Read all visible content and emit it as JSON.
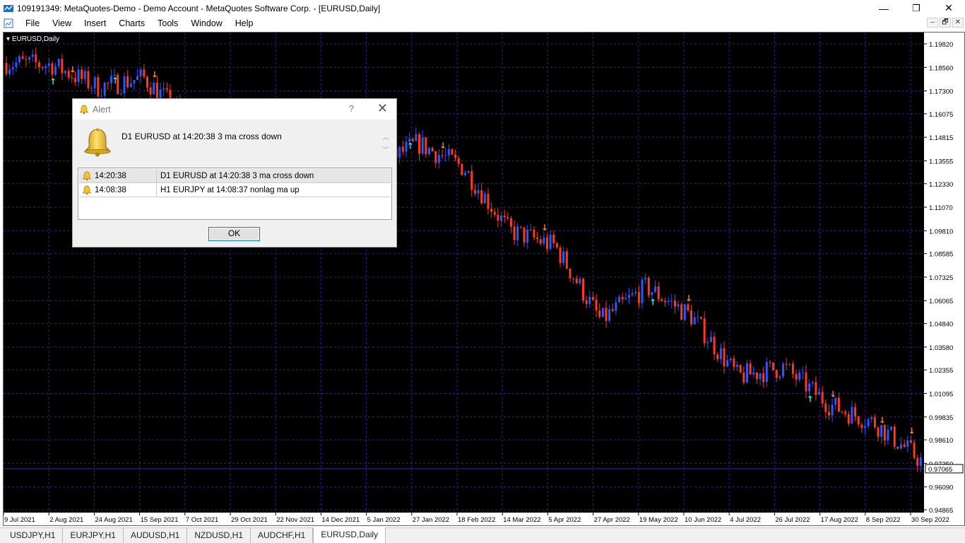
{
  "window": {
    "title": "109191349: MetaQuotes-Demo - Demo Account - MetaQuotes Software Corp. - [EURUSD,Daily]",
    "minimize": "—",
    "maximize": "❐",
    "close": "✕"
  },
  "menu": {
    "items": [
      "File",
      "View",
      "Insert",
      "Charts",
      "Tools",
      "Window",
      "Help"
    ]
  },
  "mdi_controls": [
    "–",
    "🗗",
    "✕"
  ],
  "chart": {
    "symbol_label": "EURUSD,Daily",
    "current_price": "0.97065",
    "price_levels": [
      "1.19820",
      "1.18560",
      "1.17300",
      "1.16075",
      "1.14815",
      "1.13555",
      "1.12330",
      "1.11070",
      "1.09810",
      "1.08585",
      "1.07325",
      "1.06065",
      "1.04840",
      "1.03580",
      "1.02355",
      "1.01095",
      "0.99835",
      "0.98610",
      "0.97350",
      "0.96090",
      "0.94865"
    ],
    "date_labels": [
      "9 Jul 2021",
      "2 Aug 2021",
      "24 Aug 2021",
      "15 Sep 2021",
      "7 Oct 2021",
      "29 Oct 2021",
      "22 Nov 2021",
      "14 Dec 2021",
      "5 Jan 2022",
      "27 Jan 2022",
      "18 Feb 2022",
      "14 Mar 2022",
      "5 Apr 2022",
      "27 Apr 2022",
      "19 May 2022",
      "10 Jun 2022",
      "4 Jul 2022",
      "26 Jul 2022",
      "17 Aug 2022",
      "8 Sep 2022",
      "30 Sep 2022"
    ],
    "colors": {
      "background": "#000000",
      "grid": "#3a1e8a",
      "bull": "#2f55ff",
      "bear": "#ff3a1a",
      "price_line": "#3a2a9a",
      "up_arrow": "#29e6e6",
      "down_arrow": "#ff8040",
      "axis_text": "#000000"
    }
  },
  "chart_data": {
    "type": "candlestick",
    "price_range": [
      0.94865,
      1.1982
    ],
    "close_path": [
      {
        "date": "9 Jul 2021",
        "close": 1.188
      },
      {
        "date": "2 Aug 2021",
        "close": 1.187
      },
      {
        "date": "24 Aug 2021",
        "close": 1.175
      },
      {
        "date": "15 Sep 2021",
        "close": 1.18
      },
      {
        "date": "7 Oct 2021",
        "close": 1.157
      },
      {
        "date": "29 Oct 2021",
        "close": 1.156
      },
      {
        "date": "22 Nov 2021",
        "close": 1.128
      },
      {
        "date": "14 Dec 2021",
        "close": 1.128
      },
      {
        "date": "5 Jan 2022",
        "close": 1.131
      },
      {
        "date": "27 Jan 2022",
        "close": 1.145
      },
      {
        "date": "18 Feb 2022",
        "close": 1.132
      },
      {
        "date": "14 Mar 2022",
        "close": 1.098
      },
      {
        "date": "5 Apr 2022",
        "close": 1.09
      },
      {
        "date": "27 Apr 2022",
        "close": 1.05
      },
      {
        "date": "19 May 2022",
        "close": 1.068
      },
      {
        "date": "10 Jun 2022",
        "close": 1.052
      },
      {
        "date": "4 Jul 2022",
        "close": 1.02
      },
      {
        "date": "26 Jul 2022",
        "close": 1.025
      },
      {
        "date": "17 Aug 2022",
        "close": 1.005
      },
      {
        "date": "8 Sep 2022",
        "close": 0.995
      },
      {
        "date": "30 Sep 2022",
        "close": 0.975
      }
    ]
  },
  "alert": {
    "title": "Alert",
    "help": "?",
    "close": "✕",
    "message": "D1 EURUSD at 14:20:38 3 ma cross down",
    "rows": [
      {
        "time": "14:20:38",
        "text": "D1 EURUSD at 14:20:38 3 ma cross down"
      },
      {
        "time": "14:08:38",
        "text": "H1 EURJPY at 14:08:37 nonlag ma up"
      }
    ],
    "ok_label": "OK"
  },
  "tabs": [
    {
      "label": "USDJPY,H1",
      "active": false
    },
    {
      "label": "EURJPY,H1",
      "active": false
    },
    {
      "label": "AUDUSD,H1",
      "active": false
    },
    {
      "label": "NZDUSD,H1",
      "active": false
    },
    {
      "label": "AUDCHF,H1",
      "active": false
    },
    {
      "label": "EURUSD,Daily",
      "active": true
    }
  ]
}
